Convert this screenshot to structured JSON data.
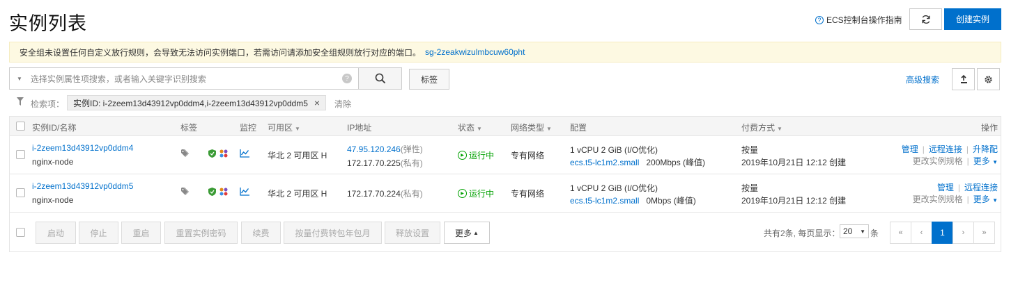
{
  "header": {
    "title": "实例列表",
    "guide_label": "ECS控制台操作指南",
    "create_label": "创建实例"
  },
  "notice": {
    "text": "安全组未设置任何自定义放行规则，会导致无法访问实例端口，若需访问请添加安全组规则放行对应的端口。",
    "link": "sg-2zeakwizulmbcuw60pht"
  },
  "search": {
    "placeholder": "选择实例属性项搜索，或者输入关键字识别搜索",
    "tag_label": "标签",
    "advanced_label": "高级搜索"
  },
  "filter": {
    "label": "检索项：",
    "chip": "实例ID: i-2zeem13d43912vp0ddm4,i-2zeem13d43912vp0ddm5",
    "clear_label": "清除"
  },
  "table": {
    "columns": {
      "id": "实例ID/名称",
      "tag": "标签",
      "monitor": "监控",
      "zone": "可用区",
      "ip": "IP地址",
      "status": "状态",
      "network": "网络类型",
      "config": "配置",
      "billing": "付费方式",
      "ops": "操作"
    },
    "rows": [
      {
        "id": "i-2zeem13d43912vp0ddm4",
        "name": "nginx-node",
        "zone": "华北 2 可用区 H",
        "ip_public": "47.95.120.246",
        "ip_public_suffix": "(弹性)",
        "ip_private": "172.17.70.225",
        "ip_private_suffix": "(私有)",
        "status": "运行中",
        "network": "专有网络",
        "config_spec": "1 vCPU 2 GiB (I/O优化)",
        "config_type": "ecs.t5-lc1m2.small",
        "bandwidth": "200Mbps (峰值)",
        "billing": "按量",
        "created": "2019年10月21日 12:12 创建",
        "op_manage": "管理",
        "op_remote": "远程连接",
        "op_upgrade": "升降配",
        "op_change": "更改实例规格",
        "op_more": "更多"
      },
      {
        "id": "i-2zeem13d43912vp0ddm5",
        "name": "nginx-node",
        "zone": "华北 2 可用区 H",
        "ip_private": "172.17.70.224",
        "ip_private_suffix": "(私有)",
        "status": "运行中",
        "network": "专有网络",
        "config_spec": "1 vCPU 2 GiB (I/O优化)",
        "config_type": "ecs.t5-lc1m2.small",
        "bandwidth": "0Mbps (峰值)",
        "billing": "按量",
        "created": "2019年10月21日 12:12 创建",
        "op_manage": "管理",
        "op_remote": "远程连接",
        "op_change": "更改实例规格",
        "op_more": "更多"
      }
    ]
  },
  "footer": {
    "actions": [
      "启动",
      "停止",
      "重启",
      "重置实例密码",
      "续费",
      "按量付费转包年包月",
      "释放设置"
    ],
    "more_label": "更多",
    "total_text": "共有2条, 每页显示：",
    "page_size": "20",
    "page_size_suffix": "条",
    "first": "«",
    "prev": "‹",
    "current_page": "1",
    "next": "›",
    "last": "»"
  },
  "colors": {
    "accent": "#0070cc",
    "running": "#00a100",
    "notice_bg": "#fdf9e2"
  }
}
